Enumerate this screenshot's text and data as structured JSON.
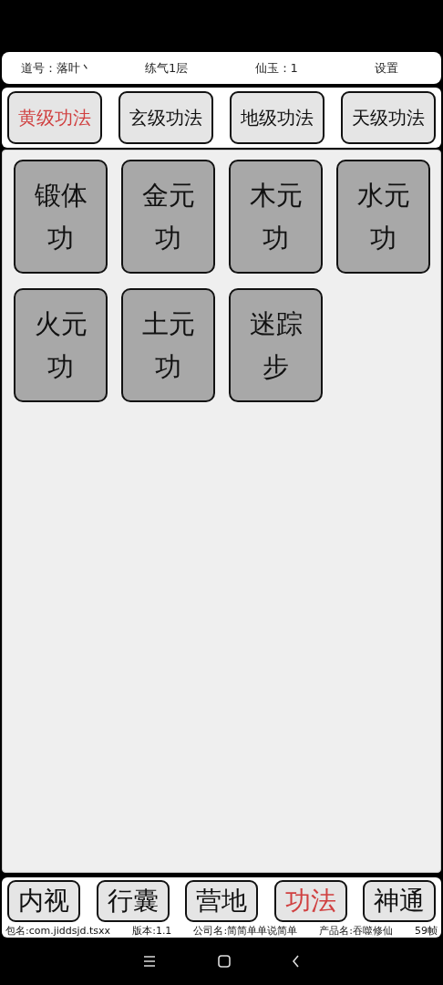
{
  "header": {
    "items": [
      {
        "text": "道号：落叶丶"
      },
      {
        "text": "练气1层"
      },
      {
        "text": "仙玉：1"
      },
      {
        "text": "设置"
      }
    ]
  },
  "tabs": [
    {
      "label": "黄级功法",
      "selected": true
    },
    {
      "label": "玄级功法",
      "selected": false
    },
    {
      "label": "地级功法",
      "selected": false
    },
    {
      "label": "天级功法",
      "selected": false
    }
  ],
  "skills": [
    {
      "label": "锻体功"
    },
    {
      "label": "金元功"
    },
    {
      "label": "木元功"
    },
    {
      "label": "水元功"
    },
    {
      "label": "火元功"
    },
    {
      "label": "土元功"
    },
    {
      "label": "迷踪步"
    }
  ],
  "bottom_nav": [
    {
      "label": "内视",
      "selected": false
    },
    {
      "label": "行囊",
      "selected": false
    },
    {
      "label": "营地",
      "selected": false
    },
    {
      "label": "功法",
      "selected": true
    },
    {
      "label": "神通",
      "selected": false
    }
  ],
  "info_line": [
    "包名:com.jiddsjd.tsxx",
    "版本:1.1",
    "公司名:简简单单说简单",
    "产品名:吞噬修仙",
    "59帧"
  ],
  "system_nav": [
    {
      "kind": "menu"
    },
    {
      "kind": "home"
    },
    {
      "kind": "back"
    }
  ]
}
